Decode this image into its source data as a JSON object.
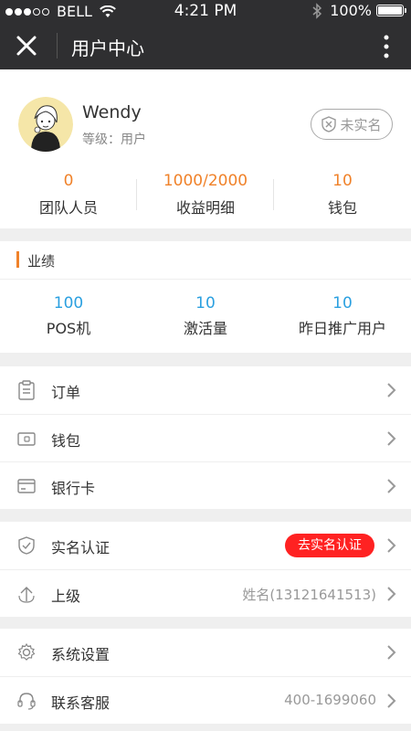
{
  "status_bar": {
    "carrier": "BELL",
    "time": "4:21 PM",
    "battery": "100%"
  },
  "nav": {
    "title": "用户中心",
    "close_icon": "close-icon",
    "more_icon": "more-vertical-icon"
  },
  "profile": {
    "name": "Wendy",
    "level": "等级：用户",
    "verify_status": "未实名",
    "stats": [
      {
        "value": "0",
        "label": "团队人员"
      },
      {
        "value": "1000/2000",
        "label": "收益明细"
      },
      {
        "value": "10",
        "label": "钱包"
      }
    ]
  },
  "performance": {
    "title": "业绩",
    "stats": [
      {
        "value": "100",
        "label": "POS机"
      },
      {
        "value": "10",
        "label": "激活量"
      },
      {
        "value": "10",
        "label": "昨日推广用户"
      }
    ]
  },
  "menu_group_1": [
    {
      "label": "订单",
      "icon": "clipboard-icon"
    },
    {
      "label": "钱包",
      "icon": "wallet-icon"
    },
    {
      "label": "银行卡",
      "icon": "bank-card-icon"
    }
  ],
  "menu_group_2": [
    {
      "label": "实名认证",
      "icon": "shield-icon",
      "badge": "去实名认证"
    },
    {
      "label": "上级",
      "icon": "upload-arrow-icon",
      "value": "姓名(13121641513)"
    }
  ],
  "menu_group_3": [
    {
      "label": "系统设置",
      "icon": "gear-icon"
    },
    {
      "label": "联系客服",
      "icon": "headset-icon",
      "value": "400-1699060"
    }
  ],
  "colors": {
    "accent_orange": "#f0822a",
    "accent_blue": "#2ba0e0",
    "badge_red": "#ff2222",
    "header_bg": "#2f2f31"
  }
}
